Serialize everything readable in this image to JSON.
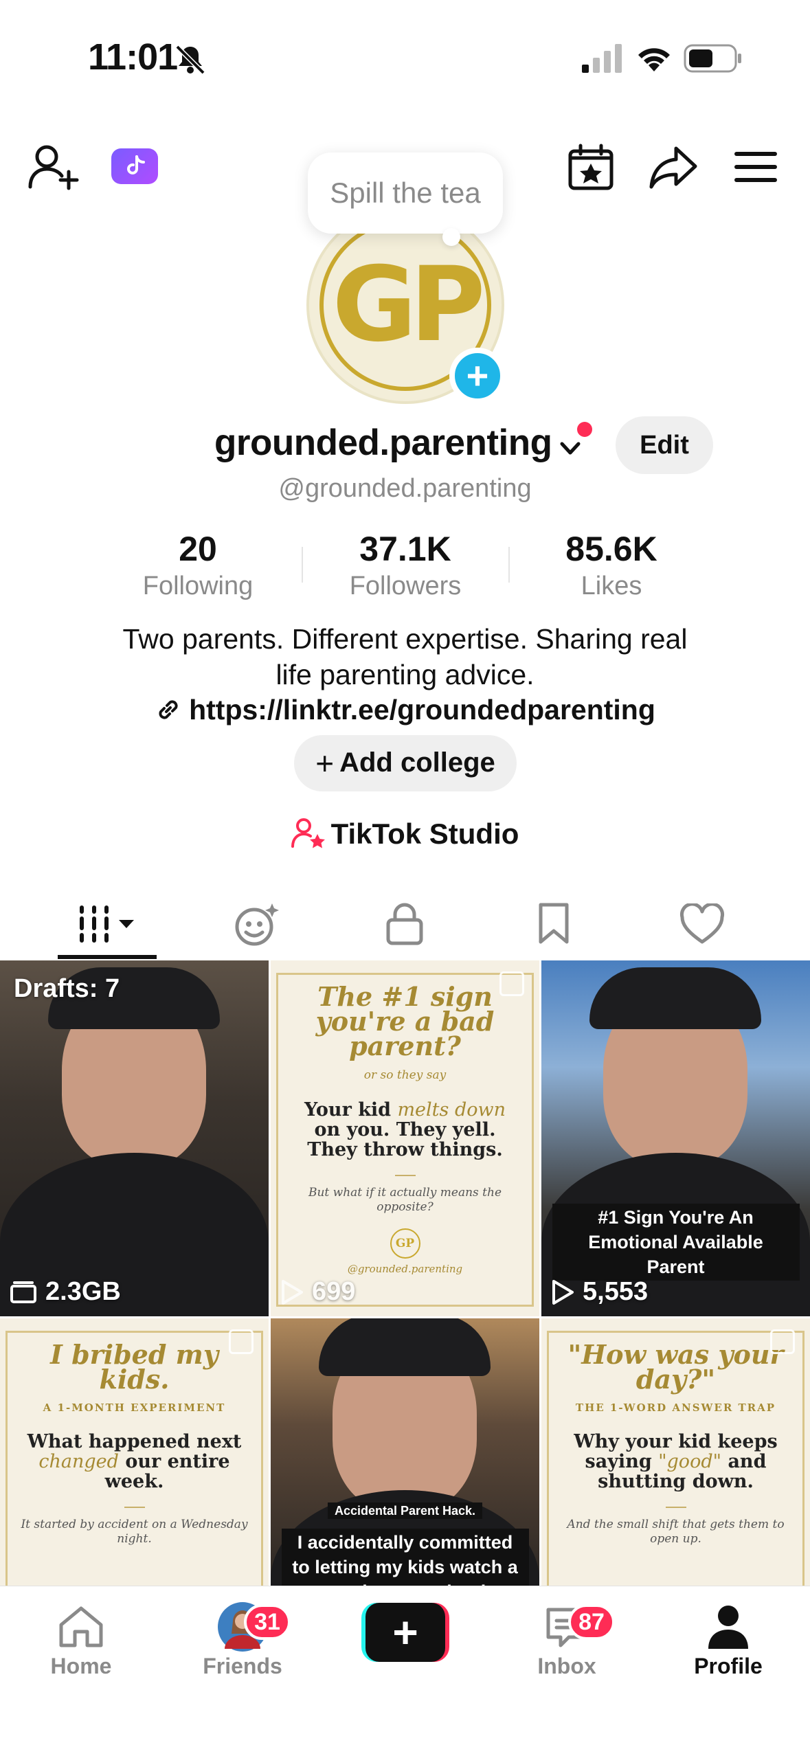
{
  "status_bar": {
    "time": "11:01"
  },
  "tooltip": {
    "text": "Spill the tea"
  },
  "avatar": {
    "initials": "GP"
  },
  "profile": {
    "display_name": "grounded.parenting",
    "handle": "@grounded.parenting",
    "edit_label": "Edit",
    "bio": "Two parents. Different expertise. Sharing real life parenting advice.",
    "link": "https://linktr.ee/groundedparenting",
    "add_college_label": "Add college",
    "studio_label": "TikTok Studio"
  },
  "stats": [
    {
      "value": "20",
      "label": "Following"
    },
    {
      "value": "37.1K",
      "label": "Followers"
    },
    {
      "value": "85.6K",
      "label": "Likes"
    }
  ],
  "grid": {
    "drafts": {
      "label": "Drafts: 7",
      "storage": "2.3GB"
    },
    "post1": {
      "title": "The #1 sign you're a bad parent?",
      "subtitle": "or so they say",
      "body_a": "Your kid",
      "body_em": "melts down",
      "body_b": "on you. They yell. They throw things.",
      "small": "But what if it actually means the opposite?",
      "mark": "GP",
      "foot": "@grounded.parenting",
      "views": "699"
    },
    "post2": {
      "caption": "#1 Sign You're An Emotional Available Parent",
      "views": "5,553"
    },
    "post3": {
      "title": "I bribed my kids.",
      "kicker": "A 1-MONTH EXPERIMENT",
      "body_a": "What happened next",
      "body_em": "changed",
      "body_b": "our entire week.",
      "small": "It started by accident on a Wednesday night."
    },
    "post4": {
      "caption_small": "Accidental Parent Hack.",
      "caption": "I accidentally committed to letting my kids watch a movie on a school"
    },
    "post5": {
      "title": "\"How was your day?\"",
      "kicker": "THE 1-WORD ANSWER TRAP",
      "body_a": "Why your kid keeps saying",
      "body_em": "\"good\"",
      "body_b": "and shutting down.",
      "small": "And the small shift that gets them to open up."
    }
  },
  "bottom_nav": [
    {
      "label": "Home",
      "icon": "home-icon"
    },
    {
      "label": "Friends",
      "icon": "friends-avatar",
      "badge": "31"
    },
    {
      "label": "",
      "icon": "plus-icon"
    },
    {
      "label": "Inbox",
      "icon": "inbox-icon",
      "badge": "87"
    },
    {
      "label": "Profile",
      "icon": "profile-icon"
    }
  ],
  "colors": {
    "accent_red": "#fe2c55",
    "accent_cyan": "#25f4ee",
    "brand_gold": "#c9a82e",
    "plus_blue": "#1fb6e8"
  }
}
